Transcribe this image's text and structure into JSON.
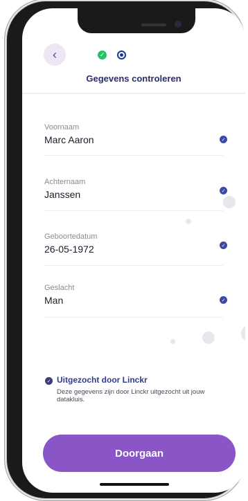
{
  "header": {
    "back_icon": "chevron-left-icon",
    "title": "Gegevens controleren",
    "steps": [
      {
        "state": "done",
        "icon": "check-icon",
        "color": "#22c55e"
      },
      {
        "state": "active",
        "color": "#1f3a8a"
      }
    ]
  },
  "fields": [
    {
      "label": "Voornaam",
      "value": "Marc Aaron",
      "verified": true
    },
    {
      "label": "Achternaam",
      "value": "Janssen",
      "verified": true
    },
    {
      "label": "Geboortedatum",
      "value": "26-05-1972",
      "verified": true
    },
    {
      "label": "Geslacht",
      "value": "Man",
      "verified": true
    }
  ],
  "info": {
    "title": "Uitgezocht door Linckr",
    "text": "Deze gegevens zijn door Linckr uitgezocht uit jouw datakluis."
  },
  "cta": {
    "label": "Doorgaan",
    "color": "#8a55c6"
  },
  "colors": {
    "accent": "#8a55c6",
    "title": "#2b2b6e",
    "check": "#3b4aa6"
  }
}
